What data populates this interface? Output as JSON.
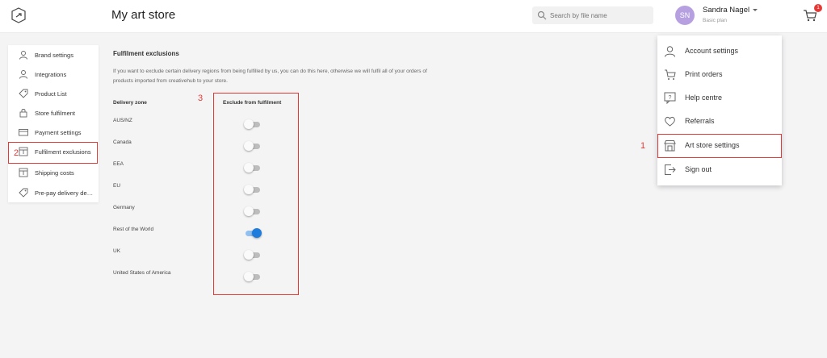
{
  "header": {
    "title": "My art store",
    "search_placeholder": "Search by file name",
    "user": {
      "initials": "SN",
      "name": "Sandra Nagel",
      "plan": "Basic plan"
    },
    "cart_count": "1"
  },
  "sidebar": {
    "items": [
      {
        "label": "Brand settings",
        "icon": "person-icon"
      },
      {
        "label": "Integrations",
        "icon": "person-icon"
      },
      {
        "label": "Product List",
        "icon": "tag-icon"
      },
      {
        "label": "Store fulfilment",
        "icon": "lock-icon"
      },
      {
        "label": "Payment settings",
        "icon": "card-icon"
      },
      {
        "label": "Fulfilment exclusions",
        "icon": "box-icon"
      },
      {
        "label": "Shipping costs",
        "icon": "box-icon"
      },
      {
        "label": "Pre-pay delivery details",
        "icon": "tag-icon"
      }
    ]
  },
  "main": {
    "section_title": "Fulfilment exclusions",
    "description": "If you want to exclude certain delivery regions from being fulfilled by us, you can do this here, otherwise we will fulfil all of your orders of products imported from creativehub to your store.",
    "col_zone": "Delivery zone",
    "col_exclude": "Exclude from fulfilment",
    "zones": [
      {
        "name": "AUS/NZ",
        "excluded": false
      },
      {
        "name": "Canada",
        "excluded": false
      },
      {
        "name": "EEA",
        "excluded": false
      },
      {
        "name": "EU",
        "excluded": false
      },
      {
        "name": "Germany",
        "excluded": false
      },
      {
        "name": "Rest of the World",
        "excluded": true
      },
      {
        "name": "UK",
        "excluded": false
      },
      {
        "name": "United States of America",
        "excluded": false
      }
    ]
  },
  "dropdown": {
    "items": [
      {
        "label": "Account settings",
        "icon": "person-icon"
      },
      {
        "label": "Print orders",
        "icon": "cart-icon"
      },
      {
        "label": "Help centre",
        "icon": "help-icon"
      },
      {
        "label": "Referrals",
        "icon": "heart-icon"
      },
      {
        "label": "Art store settings",
        "icon": "store-icon"
      },
      {
        "label": "Sign out",
        "icon": "signout-icon"
      }
    ]
  },
  "annotations": {
    "n1": "1",
    "n2": "2",
    "n3": "3"
  },
  "colors": {
    "accent": "#1e7ddc",
    "annotation": "#e53935",
    "avatar": "#b7a0e0"
  }
}
